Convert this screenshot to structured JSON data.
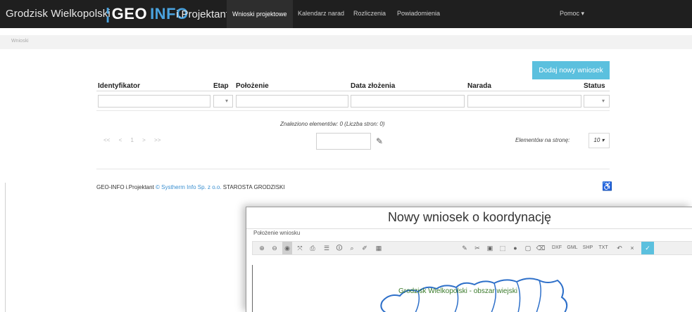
{
  "navbar": {
    "city": "Grodzisk Wielkopolski",
    "logo_bar": "¦",
    "logo_geo": "GEO",
    "logo_info": "INFO",
    "product": "i.Projektant",
    "items": [
      {
        "label": "Wnioski projektowe",
        "active": true
      },
      {
        "label": "Kalendarz narad",
        "active": false
      },
      {
        "label": "Rozliczenia",
        "active": false
      },
      {
        "label": "Powiadomienia",
        "active": false
      }
    ],
    "help": "Pomoc ▾"
  },
  "breadcrumb": {
    "current": "Wnioski"
  },
  "actions": {
    "add_new": "Dodaj nowy wniosek"
  },
  "table": {
    "columns": [
      "Identyfikator",
      "Etap",
      "Położenie",
      "Data złożenia",
      "Narada",
      "Status"
    ],
    "etap_filter": "▾",
    "status_filter": "▾",
    "found_text": "Znaleziono elementów: 0 (Liczba stron: 0)"
  },
  "pager": {
    "nav": "<< < 1 > >>",
    "go_icon": "edit-icon",
    "go_glyph": "✎",
    "per_page_label": "Elementów na stronę:",
    "per_page_value": "10 ▾"
  },
  "footer": {
    "product": "GEO-INFO i.Projektant",
    "copyright_symbol": "©",
    "company": "Systherm Info Sp. z o.o.",
    "authority": "STAROSTA GRODZISKI",
    "accessibility_icon": "accessibility-icon",
    "accessibility_glyph": "♿"
  },
  "modal": {
    "title": "Nowy wniosek o koordynację",
    "location_label": "Położenie wniosku",
    "toolbar_left": [
      "⊕",
      "⊖",
      "◉",
      "⤧",
      "⎙",
      "☰",
      "🛈",
      "⌕",
      "✐",
      "▦"
    ],
    "toolbar_right": [
      "✎",
      "✂",
      "▣",
      "⬚",
      "●",
      "▢",
      "⌫"
    ],
    "formats": [
      "DXF",
      "GML",
      "SHP",
      "TXT"
    ],
    "undo": "↶",
    "close": "×",
    "ok": "✓",
    "map_label": "Grodzisk Wielkopolski - obszar wiejski"
  },
  "colors": {
    "nav_bg": "#1f1f1f",
    "accent": "#5bc0de",
    "logo_blue": "#4aa3df"
  }
}
